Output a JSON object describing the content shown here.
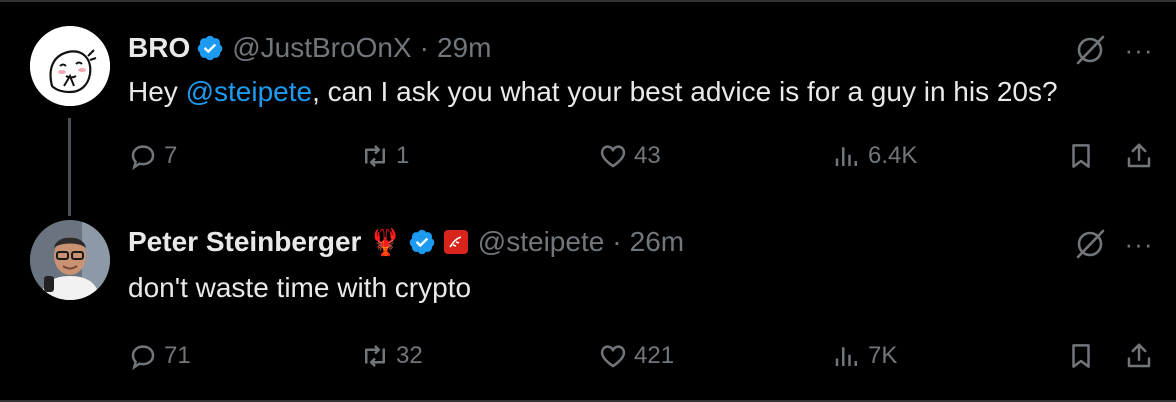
{
  "tweets": [
    {
      "name": "BRO",
      "handle": "@JustBroOnX",
      "separator": "·",
      "time": "29m",
      "text_before": "Hey ",
      "mention": "@steipete",
      "text_after": ", can I ask you what your best advice is for a guy in his 20s?",
      "replies": "7",
      "reposts": "1",
      "likes": "43",
      "views": "6.4K",
      "more": "···"
    },
    {
      "name": "Peter Steinberger",
      "emoji": "🦞",
      "handle": "@steipete",
      "separator": "·",
      "time": "26m",
      "text": "don't waste time with crypto",
      "replies": "71",
      "reposts": "32",
      "likes": "421",
      "views": "7K",
      "more": "···"
    }
  ],
  "colors": {
    "background": "#000000",
    "text": "#e7e9ea",
    "muted": "#71767b",
    "accent": "#1d9bf0"
  },
  "icons": [
    "verified-badge-icon",
    "grok-icon",
    "more-icon",
    "reply-icon",
    "repost-icon",
    "like-icon",
    "views-icon",
    "bookmark-icon",
    "share-icon"
  ]
}
